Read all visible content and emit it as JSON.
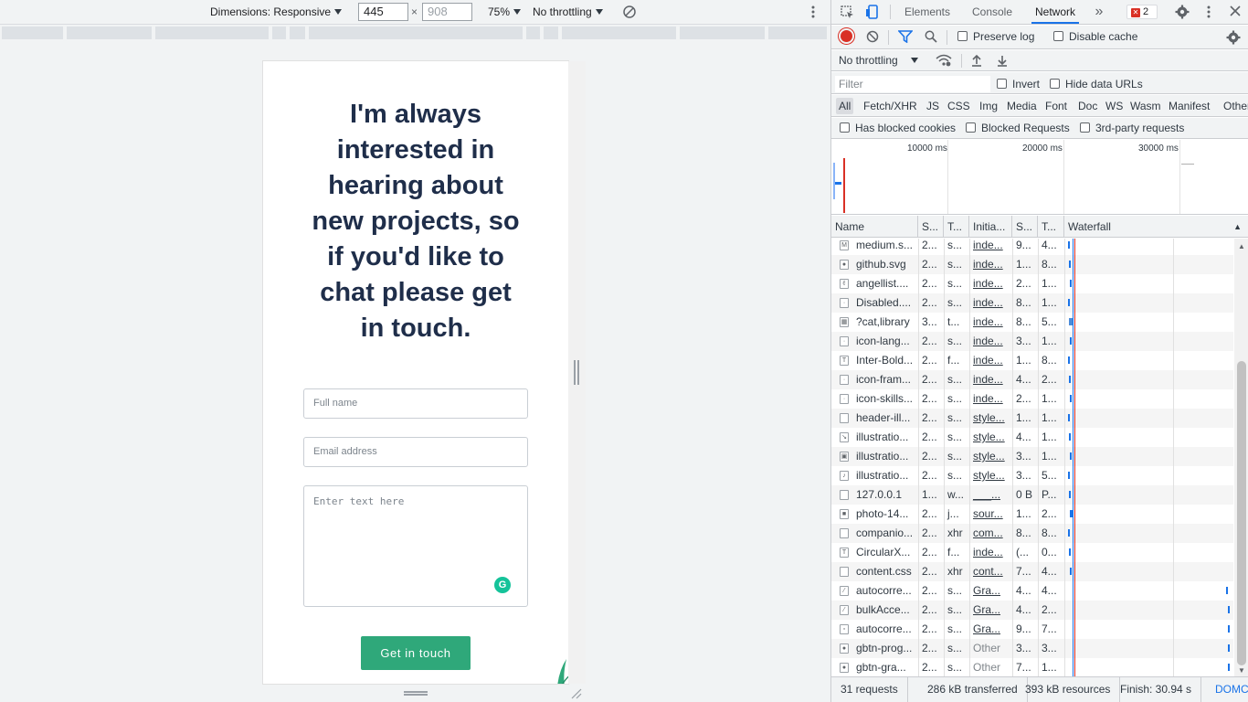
{
  "device_toolbar": {
    "dimensions_label": "Dimensions: Responsive",
    "width_value": "445",
    "height_placeholder": "908",
    "times_symbol": "×",
    "zoom": "75%",
    "throttling": "No throttling"
  },
  "page": {
    "heading": "I'm always interested in hearing about new projects, so if you'd like to chat please get in touch.",
    "full_name_placeholder": "Full name",
    "email_placeholder": "Email address",
    "message_placeholder": "Enter text here",
    "submit_label": "Get in touch",
    "grammarly_glyph": "G"
  },
  "devtools": {
    "tabs": [
      "Elements",
      "Console",
      "Network"
    ],
    "more_tabs": "»",
    "error_count": "2",
    "toolbar": {
      "preserve_log": "Preserve log",
      "disable_cache": "Disable cache",
      "throttling": "No throttling"
    },
    "filter": {
      "placeholder": "Filter",
      "invert": "Invert",
      "hide_data_urls": "Hide data URLs"
    },
    "types": [
      "All",
      "Fetch/XHR",
      "JS",
      "CSS",
      "Img",
      "Media",
      "Font",
      "Doc",
      "WS",
      "Wasm",
      "Manifest",
      "Other"
    ],
    "extra_filters": [
      "Has blocked cookies",
      "Blocked Requests",
      "3rd-party requests"
    ],
    "overview_ticks": [
      "10000 ms",
      "20000 ms",
      "30000 ms"
    ],
    "columns": [
      "Name",
      "S...",
      "T...",
      "Initia...",
      "S...",
      "T...",
      "Waterfall"
    ],
    "rows": [
      {
        "name": "medium.s...",
        "status": "2...",
        "type": "s...",
        "initiator": "inde...",
        "size": "9...",
        "time": "4...",
        "icon": "M"
      },
      {
        "name": "github.svg",
        "status": "2...",
        "type": "s...",
        "initiator": "inde...",
        "size": "1...",
        "time": "8...",
        "icon": "●"
      },
      {
        "name": "angellist....",
        "status": "2...",
        "type": "s...",
        "initiator": "inde...",
        "size": "2...",
        "time": "1...",
        "icon": "✌"
      },
      {
        "name": "Disabled....",
        "status": "2...",
        "type": "s...",
        "initiator": "inde...",
        "size": "8...",
        "time": "1...",
        "icon": "·"
      },
      {
        "name": "?cat,library",
        "status": "3...",
        "type": "t...",
        "initiator": "inde...",
        "size": "8...",
        "time": "5...",
        "icon": "▦"
      },
      {
        "name": "icon-lang...",
        "status": "2...",
        "type": "s...",
        "initiator": "inde...",
        "size": "3...",
        "time": "1...",
        "icon": "·"
      },
      {
        "name": "Inter-Bold...",
        "status": "2...",
        "type": "f...",
        "initiator": "inde...",
        "size": "1...",
        "time": "8...",
        "icon": "T"
      },
      {
        "name": "icon-fram...",
        "status": "2...",
        "type": "s...",
        "initiator": "inde...",
        "size": "4...",
        "time": "2...",
        "icon": "·"
      },
      {
        "name": "icon-skills...",
        "status": "2...",
        "type": "s...",
        "initiator": "inde...",
        "size": "2...",
        "time": "1...",
        "icon": "·"
      },
      {
        "name": "header-ill...",
        "status": "2...",
        "type": "s...",
        "initiator": "style...",
        "size": "1...",
        "time": "1...",
        "icon": ""
      },
      {
        "name": "illustratio...",
        "status": "2...",
        "type": "s...",
        "initiator": "style...",
        "size": "4...",
        "time": "1...",
        "icon": "↘"
      },
      {
        "name": "illustratio...",
        "status": "2...",
        "type": "s...",
        "initiator": "style...",
        "size": "3...",
        "time": "1...",
        "icon": "▣"
      },
      {
        "name": "illustratio...",
        "status": "2...",
        "type": "s...",
        "initiator": "style...",
        "size": "3...",
        "time": "5...",
        "icon": "♪"
      },
      {
        "name": "127.0.0.1",
        "status": "1...",
        "type": "w...",
        "initiator": "___...",
        "size": "0 B",
        "time": "P...",
        "icon": ""
      },
      {
        "name": "photo-14...",
        "status": "2...",
        "type": "j...",
        "initiator": "sour...",
        "size": "1...",
        "time": "2...",
        "icon": "■"
      },
      {
        "name": "companio...",
        "status": "2...",
        "type": "xhr",
        "initiator": "com...",
        "size": "8...",
        "time": "8...",
        "icon": ""
      },
      {
        "name": "CircularX...",
        "status": "2...",
        "type": "f...",
        "initiator": "inde...",
        "size": "(...",
        "time": "0...",
        "icon": "T"
      },
      {
        "name": "content.css",
        "status": "2...",
        "type": "xhr",
        "initiator": "cont...",
        "size": "7...",
        "time": "4...",
        "icon": ""
      },
      {
        "name": "autocorre...",
        "status": "2...",
        "type": "s...",
        "initiator": "Gra...",
        "size": "4...",
        "time": "4...",
        "icon": "⁄"
      },
      {
        "name": "bulkAcce...",
        "status": "2...",
        "type": "s...",
        "initiator": "Gra...",
        "size": "4...",
        "time": "2...",
        "icon": "⁄"
      },
      {
        "name": "autocorre...",
        "status": "2...",
        "type": "s...",
        "initiator": "Gra...",
        "size": "9...",
        "time": "7...",
        "icon": "▫"
      },
      {
        "name": "gbtn-prog...",
        "status": "2...",
        "type": "s...",
        "initiator": "Other",
        "size": "3...",
        "time": "3...",
        "icon": "●"
      },
      {
        "name": "gbtn-gra...",
        "status": "2...",
        "type": "s...",
        "initiator": "Other",
        "size": "7...",
        "time": "1...",
        "icon": "●"
      }
    ],
    "status_bar": {
      "requests": "31 requests",
      "transferred": "286 kB transferred",
      "resources": "393 kB resources",
      "finish": "Finish: 30.94 s",
      "domcontent": "DOMC"
    }
  },
  "colors": {
    "accent": "#1a73e8",
    "record": "#d93025",
    "submit_button": "#2fa87a",
    "heading": "#1f2e4a",
    "grammarly": "#15c39a"
  }
}
